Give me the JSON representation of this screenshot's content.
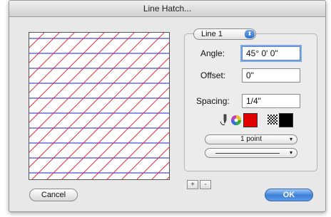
{
  "window": {
    "title": "Line Hatch..."
  },
  "hatch_popup": {
    "value": "Line 1",
    "arrows_glyph": "⬍"
  },
  "fields": {
    "angle": {
      "label": "Angle:",
      "value": "45° 0' 0\""
    },
    "offset": {
      "label": "Offset:",
      "value": "0\""
    },
    "spacing": {
      "label": "Spacing:",
      "value": "1/4\""
    }
  },
  "icons": {
    "pen": "pen-icon",
    "color_wheel": "color-wheel-icon",
    "pattern": "pattern-icon"
  },
  "colors": {
    "line_color": "#e00000",
    "pattern_fill": "#000000",
    "preview_red": "#e0303c",
    "preview_blue": "#4a4ad8",
    "ok_blue": "#3c7fd8"
  },
  "line_weight_popup": {
    "value": "1 point",
    "arrow": "▾"
  },
  "line_style_popup": {
    "value": "",
    "arrow": "▾"
  },
  "plus_minus": {
    "plus": "+",
    "minus": "-"
  },
  "buttons": {
    "cancel": "Cancel",
    "ok": "OK"
  }
}
